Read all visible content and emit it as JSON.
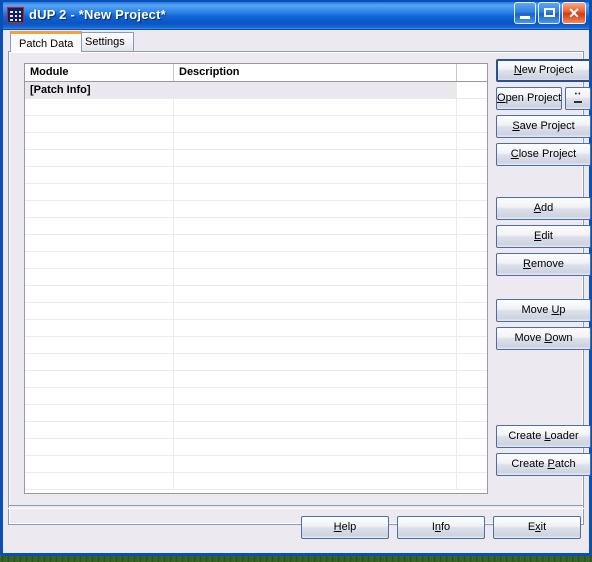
{
  "window": {
    "title": "dUP 2 - *New Project*",
    "icon": "dup-app-icon",
    "controls": {
      "minimize": "minimize-icon",
      "maximize": "maximize-icon",
      "close": "close-icon"
    }
  },
  "tabs": [
    {
      "label": "Patch Data",
      "active": true
    },
    {
      "label": "Settings",
      "active": false
    }
  ],
  "listview": {
    "columns": [
      {
        "label": "Module"
      },
      {
        "label": "Description"
      },
      {
        "label": ""
      }
    ],
    "rows": [
      {
        "module": "[Patch Info]",
        "description": "",
        "extra": "",
        "section": true
      }
    ],
    "empty_row_count": 23
  },
  "side_buttons": {
    "project": [
      {
        "label": "New Project",
        "accel": "N",
        "default": true
      },
      {
        "label": "Open Project",
        "accel": "O",
        "has_extra": true
      },
      {
        "label": "Save Project",
        "accel": "S"
      },
      {
        "label": "Close Project",
        "accel": "C"
      }
    ],
    "open_extra_label": "",
    "edit": [
      {
        "label": "Add",
        "accel": "A"
      },
      {
        "label": "Edit",
        "accel": "E"
      },
      {
        "label": "Remove",
        "accel": "R"
      }
    ],
    "move": [
      {
        "label": "Move Up",
        "accel": "U"
      },
      {
        "label": "Move Down",
        "accel": "D"
      }
    ],
    "create": [
      {
        "label": "Create Loader",
        "accel": "L"
      },
      {
        "label": "Create Patch",
        "accel": "P"
      }
    ]
  },
  "bottom_buttons": [
    {
      "label": "Help",
      "accel": "H"
    },
    {
      "label": "Info",
      "accel": "n"
    },
    {
      "label": "Exit",
      "accel": "x"
    }
  ],
  "colors": {
    "titlebar_blue": "#0a60d8",
    "active_tab_accent": "#f0a33c",
    "panel_bg": "#ece9f0",
    "button_border": "#4b6ea8",
    "section_row_bg": "#eae8ee"
  }
}
